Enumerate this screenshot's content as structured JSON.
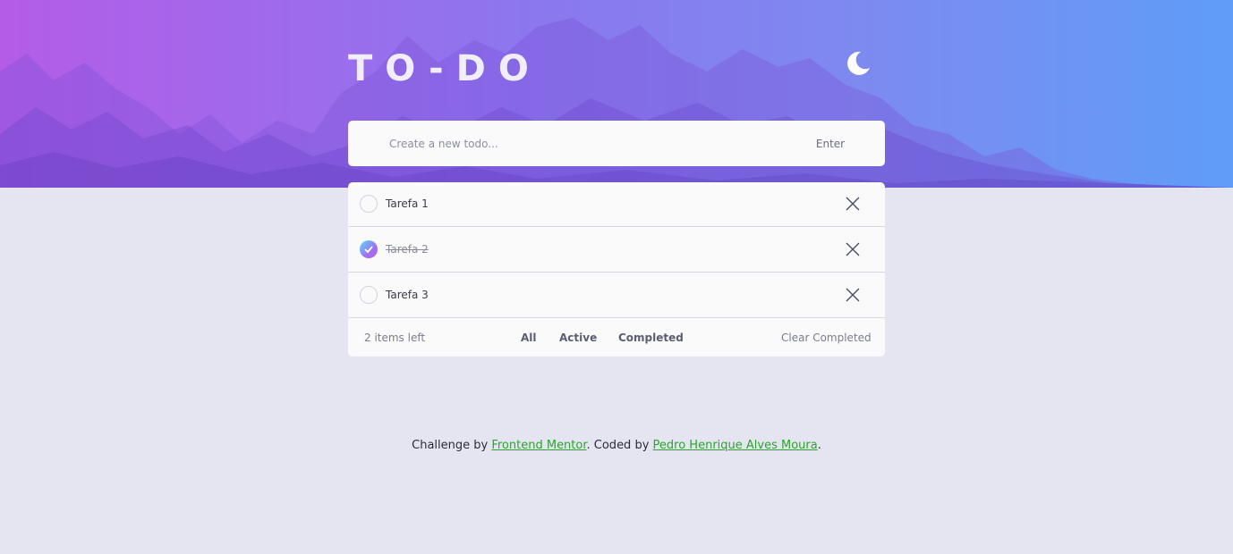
{
  "header": {
    "title": "TO-DO",
    "theme_icon": "moon-icon"
  },
  "new_todo": {
    "placeholder": "Create a new todo...",
    "value": "",
    "submit_label": "Enter"
  },
  "todos": [
    {
      "label": "Tarefa 1",
      "completed": false
    },
    {
      "label": "Tarefa 2",
      "completed": true
    },
    {
      "label": "Tarefa 3",
      "completed": false
    }
  ],
  "footer": {
    "items_left": "2 items left",
    "filters": [
      "All",
      "Active",
      "Completed"
    ],
    "clear_label": "Clear Completed"
  },
  "credits": {
    "prefix": "Challenge by ",
    "link1": "Frontend Mentor",
    "middle": ". Coded by ",
    "link2": "Pedro Henrique Alves Moura",
    "suffix": "."
  },
  "colors": {
    "page_bg": "#e4e5f1",
    "card_bg": "#fafafa",
    "check_gradient_start": "#57ddff",
    "check_gradient_end": "#c058f3",
    "link": "#2ba52b"
  }
}
